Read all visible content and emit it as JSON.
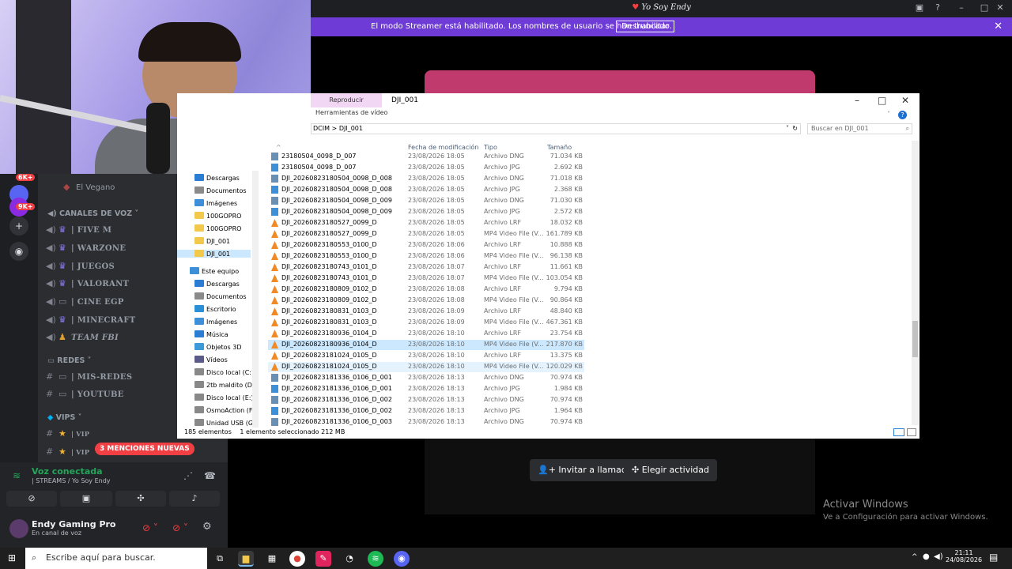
{
  "discord": {
    "window_title": "Yo Soy Endy",
    "streamer_banner": {
      "message": "El modo Streamer está habilitado. Los nombres de usuario se han truncado.",
      "button": "Deshabilitar"
    },
    "call_buttons": {
      "invite": "Invitar a llamada",
      "activity": "Elegir actividad"
    },
    "server_badges": [
      "6K+",
      "9K+"
    ],
    "channels": {
      "top_item": "El Vegano",
      "voice_category": "CANALES DE VOZ",
      "voice": [
        "| FIVE M",
        "| WARZONE",
        "| JUEGOS",
        "| VALORANT",
        "| CINE EGP",
        "| MINECRAFT",
        "TEAM FBI"
      ],
      "redes_category": "REDES",
      "redes": [
        "| MIS-REDES",
        "| YOUTUBE"
      ],
      "vips_category": "VIPS",
      "vips": [
        "| VIP",
        "| VIP"
      ],
      "mentions_badge": "3 MENCIONES NUEVAS"
    },
    "voice_panel": {
      "status": "Voz conectada",
      "channel": "| STREAMS / Yo Soy Endy",
      "username": "Endy Gaming Pro",
      "user_status": "En canal de voz"
    }
  },
  "windows_watermark": {
    "title": "Activar Windows",
    "subtitle": "Ve a Configuración para activar Windows."
  },
  "explorer": {
    "ribbon_tab": "Reproducir",
    "ribbon_context": "Herramientas de vídeo",
    "folder_title": "DJI_001",
    "address": [
      "DCIM",
      "DJI_001"
    ],
    "search_placeholder": "Buscar en DJI_001",
    "columns": {
      "date": "Fecha de modificación",
      "type": "Tipo",
      "size": "Tamaño"
    },
    "nav": {
      "quick": [
        {
          "label": "Descargas",
          "color": "#2b7cd3"
        },
        {
          "label": "Documentos",
          "color": "#8a8a8a"
        },
        {
          "label": "Imágenes",
          "color": "#3d8fd8"
        },
        {
          "label": "100GOPRO",
          "color": "#f2c94c"
        },
        {
          "label": "100GOPRO",
          "color": "#f2c94c"
        },
        {
          "label": "DJI_001",
          "color": "#f2c94c"
        },
        {
          "label": "DJI_001",
          "color": "#f2c94c"
        }
      ],
      "pc_label": "Este equipo",
      "pc": [
        {
          "label": "Descargas",
          "color": "#2b7cd3"
        },
        {
          "label": "Documentos",
          "color": "#8a8a8a"
        },
        {
          "label": "Escritorio",
          "color": "#2b8fd8"
        },
        {
          "label": "Imágenes",
          "color": "#3d8fd8"
        },
        {
          "label": "Música",
          "color": "#2b7cd3"
        },
        {
          "label": "Objetos 3D",
          "color": "#3d9ad8"
        },
        {
          "label": "Vídeos",
          "color": "#5b5b8a"
        },
        {
          "label": "Disco local (C:)",
          "color": "#888"
        },
        {
          "label": "2tb maldito (D:)",
          "color": "#888"
        },
        {
          "label": "Disco local (E:)",
          "color": "#888"
        },
        {
          "label": "OsmoAction (F:)",
          "color": "#888"
        },
        {
          "label": "Unidad USB (G:)",
          "color": "#888"
        }
      ]
    },
    "files": [
      {
        "name": "23180504_0098_D_007",
        "date": "23/08/2026 18:05",
        "type": "Archivo DNG",
        "size": "71.034 KB",
        "icon": "doc"
      },
      {
        "name": "23180504_0098_D_007",
        "date": "23/08/2026 18:05",
        "type": "Archivo JPG",
        "size": "2.692 KB",
        "icon": "img"
      },
      {
        "name": "DJI_20260823180504_0098_D_008",
        "date": "23/08/2026 18:05",
        "type": "Archivo DNG",
        "size": "71.018 KB",
        "icon": "doc"
      },
      {
        "name": "DJI_20260823180504_0098_D_008",
        "date": "23/08/2026 18:05",
        "type": "Archivo JPG",
        "size": "2.368 KB",
        "icon": "img"
      },
      {
        "name": "DJI_20260823180504_0098_D_009",
        "date": "23/08/2026 18:05",
        "type": "Archivo DNG",
        "size": "71.030 KB",
        "icon": "doc"
      },
      {
        "name": "DJI_20260823180504_0098_D_009",
        "date": "23/08/2026 18:05",
        "type": "Archivo JPG",
        "size": "2.572 KB",
        "icon": "img"
      },
      {
        "name": "DJI_20260823180527_0099_D",
        "date": "23/08/2026 18:05",
        "type": "Archivo LRF",
        "size": "18.032 KB",
        "icon": "vlc"
      },
      {
        "name": "DJI_20260823180527_0099_D",
        "date": "23/08/2026 18:05",
        "type": "MP4 Video File (V...",
        "size": "161.789 KB",
        "icon": "vlc"
      },
      {
        "name": "DJI_20260823180553_0100_D",
        "date": "23/08/2026 18:06",
        "type": "Archivo LRF",
        "size": "10.888 KB",
        "icon": "vlc"
      },
      {
        "name": "DJI_20260823180553_0100_D",
        "date": "23/08/2026 18:06",
        "type": "MP4 Video File (V...",
        "size": "96.138 KB",
        "icon": "vlc"
      },
      {
        "name": "DJI_20260823180743_0101_D",
        "date": "23/08/2026 18:07",
        "type": "Archivo LRF",
        "size": "11.661 KB",
        "icon": "vlc"
      },
      {
        "name": "DJI_20260823180743_0101_D",
        "date": "23/08/2026 18:07",
        "type": "MP4 Video File (V...",
        "size": "103.054 KB",
        "icon": "vlc"
      },
      {
        "name": "DJI_20260823180809_0102_D",
        "date": "23/08/2026 18:08",
        "type": "Archivo LRF",
        "size": "9.794 KB",
        "icon": "vlc"
      },
      {
        "name": "DJI_20260823180809_0102_D",
        "date": "23/08/2026 18:08",
        "type": "MP4 Video File (V...",
        "size": "90.864 KB",
        "icon": "vlc"
      },
      {
        "name": "DJI_20260823180831_0103_D",
        "date": "23/08/2026 18:09",
        "type": "Archivo LRF",
        "size": "48.840 KB",
        "icon": "vlc"
      },
      {
        "name": "DJI_20260823180831_0103_D",
        "date": "23/08/2026 18:09",
        "type": "MP4 Video File (V...",
        "size": "467.361 KB",
        "icon": "vlc"
      },
      {
        "name": "DJI_20260823180936_0104_D",
        "date": "23/08/2026 18:10",
        "type": "Archivo LRF",
        "size": "23.754 KB",
        "icon": "vlc"
      },
      {
        "name": "DJI_20260823180936_0104_D",
        "date": "23/08/2026 18:10",
        "type": "MP4 Video File (V...",
        "size": "217.870 KB",
        "icon": "vlc",
        "state": "sel"
      },
      {
        "name": "DJI_20260823181024_0105_D",
        "date": "23/08/2026 18:10",
        "type": "Archivo LRF",
        "size": "13.375 KB",
        "icon": "vlc"
      },
      {
        "name": "DJI_20260823181024_0105_D",
        "date": "23/08/2026 18:10",
        "type": "MP4 Video File (V...",
        "size": "120.029 KB",
        "icon": "vlc",
        "state": "hov"
      },
      {
        "name": "DJI_20260823181336_0106_D_001",
        "date": "23/08/2026 18:13",
        "type": "Archivo DNG",
        "size": "70.974 KB",
        "icon": "doc"
      },
      {
        "name": "DJI_20260823181336_0106_D_001",
        "date": "23/08/2026 18:13",
        "type": "Archivo JPG",
        "size": "1.984 KB",
        "icon": "img"
      },
      {
        "name": "DJI_20260823181336_0106_D_002",
        "date": "23/08/2026 18:13",
        "type": "Archivo DNG",
        "size": "70.974 KB",
        "icon": "doc"
      },
      {
        "name": "DJI_20260823181336_0106_D_002",
        "date": "23/08/2026 18:13",
        "type": "Archivo JPG",
        "size": "1.964 KB",
        "icon": "img"
      },
      {
        "name": "DJI_20260823181336_0106_D_003",
        "date": "23/08/2026 18:13",
        "type": "Archivo DNG",
        "size": "70.974 KB",
        "icon": "doc"
      }
    ],
    "status_count": "185 elementos",
    "status_selection": "1 elemento seleccionado  212 MB"
  },
  "taskbar": {
    "search_placeholder": "Escribe aquí para buscar.",
    "time": "21:11",
    "date": "24/08/2026"
  },
  "icon_colors": {
    "vlc": "#f08a24",
    "doc": "#6a8fb5",
    "img": "#3d8fd8"
  }
}
